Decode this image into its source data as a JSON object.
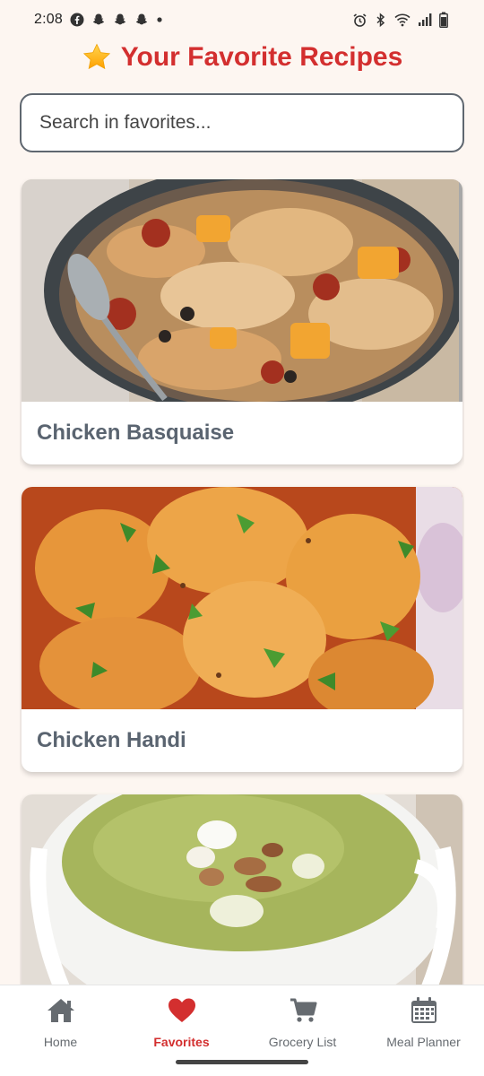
{
  "status_bar": {
    "time": "2:08",
    "left_icons": [
      "facebook-icon",
      "snapchat-icon",
      "snapchat-icon",
      "snapchat-icon",
      "dot-icon"
    ],
    "right_icons": [
      "alarm-icon",
      "bluetooth-icon",
      "wifi-icon",
      "signal-icon",
      "battery-icon"
    ]
  },
  "header": {
    "icon": "star-icon",
    "title": "Your Favorite Recipes",
    "title_color": "#D32F2F"
  },
  "search": {
    "placeholder": "Search in favorites...",
    "value": ""
  },
  "recipes": [
    {
      "title": "Chicken Basquaise",
      "image": "chicken-basquaise-photo"
    },
    {
      "title": "Chicken Handi",
      "image": "chicken-handi-photo"
    },
    {
      "title": "",
      "image": "green-soup-photo"
    }
  ],
  "bottom_nav": {
    "items": [
      {
        "label": "Home",
        "icon": "home-icon",
        "active": false
      },
      {
        "label": "Favorites",
        "icon": "heart-icon",
        "active": true
      },
      {
        "label": "Grocery List",
        "icon": "cart-icon",
        "active": false
      },
      {
        "label": "Meal Planner",
        "icon": "calendar-icon",
        "active": false
      }
    ],
    "active_color": "#D32F2F",
    "inactive_color": "#666B70"
  }
}
